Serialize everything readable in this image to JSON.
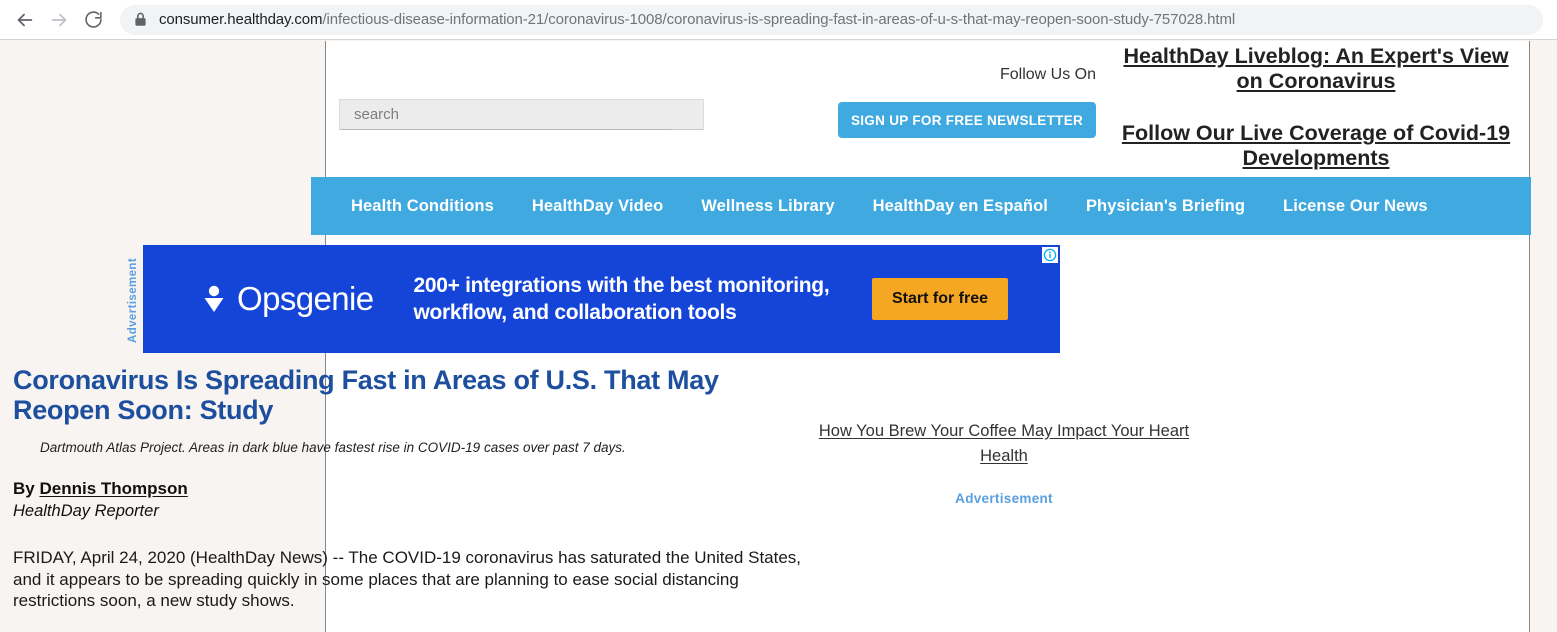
{
  "browser": {
    "back_label": "Back",
    "forward_label": "Forward",
    "reload_label": "Reload",
    "lock_label": "Connection is secure",
    "url_host": "consumer.healthday.com",
    "url_path": "/infectious-disease-information-21/coronavirus-1008/coronavirus-is-spreading-fast-in-areas-of-u-s-that-may-reopen-soon-study-757028.html"
  },
  "header": {
    "search_placeholder": "search",
    "search_value": "",
    "follow_us_label": "Follow Us On",
    "newsletter_button": "SIGN UP FOR FREE NEWSLETTER",
    "promo_links": [
      "HealthDay Liveblog: An Expert's View on Coronavirus",
      "Follow Our Live Coverage of Covid-19 Developments"
    ]
  },
  "nav": {
    "items": [
      "Health Conditions",
      "HealthDay Video",
      "Wellness Library",
      "HealthDay en Español",
      "Physician's Briefing",
      "License Our News"
    ]
  },
  "ad": {
    "vertical_label": "Advertisement",
    "brand": "Opsgenie",
    "copy": "200+ integrations with the best monitoring, workflow, and collaboration tools",
    "cta": "Start for free",
    "adchoices_label": "AdChoices"
  },
  "article": {
    "title": "Coronavirus Is Spreading Fast in Areas of U.S. That May Reopen Soon: Study",
    "caption": "Dartmouth Atlas Project. Areas in dark blue have fastest rise in COVID-19 cases over past 7 days.",
    "byline_prefix": "By ",
    "byline_author": "Dennis Thompson",
    "byline_role": "HealthDay Reporter",
    "body": "FRIDAY, April 24, 2020 (HealthDay News) -- The COVID-19 coronavirus has saturated the United States, and it appears to be spreading quickly in some places that are planning to ease social distancing restrictions soon, a new study shows."
  },
  "right_rail": {
    "link": "How You Brew Your Coffee May Impact Your Heart Health",
    "ad_label": "Advertisement"
  },
  "colors": {
    "brand_blue": "#3fa9e0",
    "ribbon_fold": "#0b5ea8",
    "headline_blue": "#1d4f9e",
    "ad_blue": "#1445d8",
    "ad_cta_orange": "#f5a623",
    "page_bg": "#f8f4f1"
  }
}
